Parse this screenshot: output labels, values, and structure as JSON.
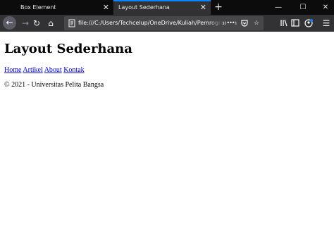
{
  "browser": {
    "tabs": [
      {
        "label": "Box Element",
        "active": false
      },
      {
        "label": "Layout Sederhana",
        "active": true
      }
    ],
    "url": "file:///C:/Users/Techcelup/OneDrive/Kuliah/Pemrograman",
    "more_label": "•••",
    "accent_color": "#0a84ff",
    "icons": [
      "close-icon",
      "new-tab-icon",
      "minimize-icon",
      "maximize-icon",
      "window-close-icon",
      "back-icon",
      "forward-icon",
      "reload-icon",
      "home-icon",
      "page-icon",
      "pocket-icon",
      "bookmark-star-icon",
      "library-icon",
      "sidebar-icon",
      "account-icon",
      "menu-icon"
    ]
  },
  "page": {
    "title": "Layout Sederhana",
    "nav": [
      "Home",
      "Artikel",
      "About",
      "Kontak"
    ],
    "footer": "© 2021 - Universitas Pelita Bangsa",
    "link_color": "#0000ee"
  }
}
